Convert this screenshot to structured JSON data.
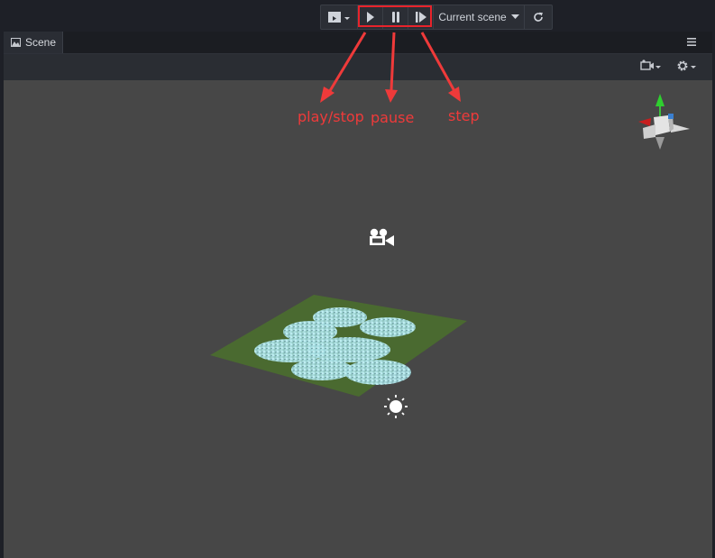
{
  "toolbar": {
    "preview_icon": "clapperboard-icon",
    "play_icon": "play-icon",
    "pause_icon": "pause-icon",
    "step_icon": "step-icon",
    "scene_label": "Current scene",
    "refresh_icon": "refresh-icon"
  },
  "panel": {
    "tab_label": "Scene",
    "menu_icon": "hamburger-icon",
    "camera_menu_icon": "camera-icon",
    "settings_icon": "gear-icon"
  },
  "annotations": {
    "play": "play/stop",
    "pause": "pause",
    "step": "step"
  },
  "colors": {
    "highlight": "#e8232b",
    "annotation": "#ef3a3a",
    "viewport": "#474747",
    "ground": "#4a6a30",
    "water": "#b9ecf0"
  }
}
